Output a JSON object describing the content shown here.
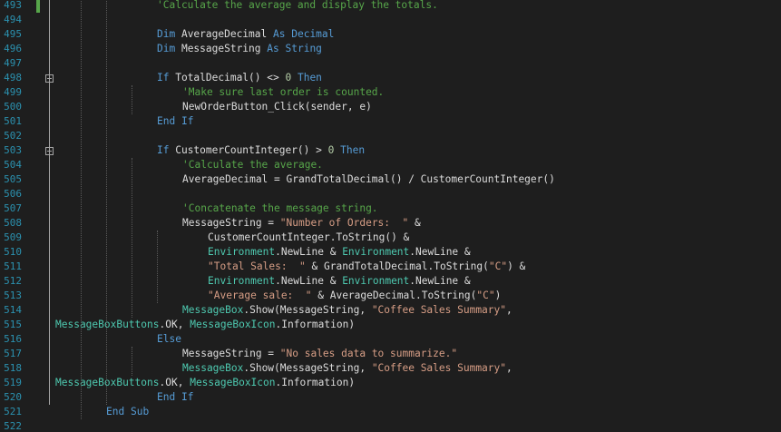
{
  "editor": {
    "lines": [
      {
        "num": "493",
        "indent": 4,
        "tokens": [
          {
            "t": "'Calculate the average and display the totals.",
            "c": "comment"
          }
        ]
      },
      {
        "num": "494",
        "indent": 0,
        "tokens": []
      },
      {
        "num": "495",
        "indent": 4,
        "tokens": [
          {
            "t": "Dim",
            "c": "keyword"
          },
          {
            "t": " AverageDecimal ",
            "c": "plain"
          },
          {
            "t": "As",
            "c": "keyword"
          },
          {
            "t": " ",
            "c": "plain"
          },
          {
            "t": "Decimal",
            "c": "keyword"
          }
        ]
      },
      {
        "num": "496",
        "indent": 4,
        "tokens": [
          {
            "t": "Dim",
            "c": "keyword"
          },
          {
            "t": " MessageString ",
            "c": "plain"
          },
          {
            "t": "As",
            "c": "keyword"
          },
          {
            "t": " ",
            "c": "plain"
          },
          {
            "t": "String",
            "c": "keyword"
          }
        ]
      },
      {
        "num": "497",
        "indent": 0,
        "tokens": []
      },
      {
        "num": "498",
        "indent": 4,
        "tokens": [
          {
            "t": "If",
            "c": "keyword"
          },
          {
            "t": " TotalDecimal() <> ",
            "c": "plain"
          },
          {
            "t": "0",
            "c": "number"
          },
          {
            "t": " ",
            "c": "plain"
          },
          {
            "t": "Then",
            "c": "keyword"
          }
        ]
      },
      {
        "num": "499",
        "indent": 5,
        "tokens": [
          {
            "t": "'Make sure last order is counted.",
            "c": "comment"
          }
        ]
      },
      {
        "num": "500",
        "indent": 5,
        "tokens": [
          {
            "t": "NewOrderButton_Click(sender, e)",
            "c": "plain"
          }
        ]
      },
      {
        "num": "501",
        "indent": 4,
        "tokens": [
          {
            "t": "End",
            "c": "keyword"
          },
          {
            "t": " ",
            "c": "plain"
          },
          {
            "t": "If",
            "c": "keyword"
          }
        ]
      },
      {
        "num": "502",
        "indent": 0,
        "tokens": []
      },
      {
        "num": "503",
        "indent": 4,
        "tokens": [
          {
            "t": "If",
            "c": "keyword"
          },
          {
            "t": " CustomerCountInteger() > ",
            "c": "plain"
          },
          {
            "t": "0",
            "c": "number"
          },
          {
            "t": " ",
            "c": "plain"
          },
          {
            "t": "Then",
            "c": "keyword"
          }
        ]
      },
      {
        "num": "504",
        "indent": 5,
        "tokens": [
          {
            "t": "'Calculate the average.",
            "c": "comment"
          }
        ]
      },
      {
        "num": "505",
        "indent": 5,
        "tokens": [
          {
            "t": "AverageDecimal = GrandTotalDecimal() / CustomerCountInteger()",
            "c": "plain"
          }
        ]
      },
      {
        "num": "506",
        "indent": 0,
        "tokens": []
      },
      {
        "num": "507",
        "indent": 5,
        "tokens": [
          {
            "t": "'Concatenate the message string.",
            "c": "comment"
          }
        ]
      },
      {
        "num": "508",
        "indent": 5,
        "tokens": [
          {
            "t": "MessageString = ",
            "c": "plain"
          },
          {
            "t": "\"Number of Orders:  \"",
            "c": "string"
          },
          {
            "t": " &",
            "c": "plain"
          }
        ]
      },
      {
        "num": "509",
        "indent": 6,
        "tokens": [
          {
            "t": "CustomerCountInteger.ToString() &",
            "c": "plain"
          }
        ]
      },
      {
        "num": "510",
        "indent": 6,
        "tokens": [
          {
            "t": "Environment",
            "c": "type"
          },
          {
            "t": ".NewLine & ",
            "c": "plain"
          },
          {
            "t": "Environment",
            "c": "type"
          },
          {
            "t": ".NewLine &",
            "c": "plain"
          }
        ]
      },
      {
        "num": "511",
        "indent": 6,
        "tokens": [
          {
            "t": "\"Total Sales:  \"",
            "c": "string"
          },
          {
            "t": " & GrandTotalDecimal.ToString(",
            "c": "plain"
          },
          {
            "t": "\"C\"",
            "c": "string"
          },
          {
            "t": ") &",
            "c": "plain"
          }
        ]
      },
      {
        "num": "512",
        "indent": 6,
        "tokens": [
          {
            "t": "Environment",
            "c": "type"
          },
          {
            "t": ".NewLine & ",
            "c": "plain"
          },
          {
            "t": "Environment",
            "c": "type"
          },
          {
            "t": ".NewLine &",
            "c": "plain"
          }
        ]
      },
      {
        "num": "513",
        "indent": 6,
        "tokens": [
          {
            "t": "\"Average sale:  \"",
            "c": "string"
          },
          {
            "t": " & AverageDecimal.ToString(",
            "c": "plain"
          },
          {
            "t": "\"C\"",
            "c": "string"
          },
          {
            "t": ")",
            "c": "plain"
          }
        ]
      },
      {
        "num": "514",
        "indent": 5,
        "tokens": [
          {
            "t": "MessageBox",
            "c": "type"
          },
          {
            "t": ".Show(MessageString, ",
            "c": "plain"
          },
          {
            "t": "\"Coffee Sales Summary\"",
            "c": "string"
          },
          {
            "t": ",",
            "c": "plain"
          }
        ]
      },
      {
        "num": "515",
        "indent": 0,
        "tokens": [
          {
            "t": "MessageBoxButtons",
            "c": "type"
          },
          {
            "t": ".OK, ",
            "c": "plain"
          },
          {
            "t": "MessageBoxIcon",
            "c": "type"
          },
          {
            "t": ".Information)",
            "c": "plain"
          }
        ]
      },
      {
        "num": "516",
        "indent": 4,
        "tokens": [
          {
            "t": "Else",
            "c": "keyword"
          }
        ]
      },
      {
        "num": "517",
        "indent": 5,
        "tokens": [
          {
            "t": "MessageString = ",
            "c": "plain"
          },
          {
            "t": "\"No sales data to summarize.\"",
            "c": "string"
          }
        ]
      },
      {
        "num": "518",
        "indent": 5,
        "tokens": [
          {
            "t": "MessageBox",
            "c": "type"
          },
          {
            "t": ".Show(MessageString, ",
            "c": "plain"
          },
          {
            "t": "\"Coffee Sales Summary\"",
            "c": "string"
          },
          {
            "t": ",",
            "c": "plain"
          }
        ]
      },
      {
        "num": "519",
        "indent": 0,
        "tokens": [
          {
            "t": "MessageBoxButtons",
            "c": "type"
          },
          {
            "t": ".OK, ",
            "c": "plain"
          },
          {
            "t": "MessageBoxIcon",
            "c": "type"
          },
          {
            "t": ".Information)",
            "c": "plain"
          }
        ]
      },
      {
        "num": "520",
        "indent": 4,
        "tokens": [
          {
            "t": "End",
            "c": "keyword"
          },
          {
            "t": " ",
            "c": "plain"
          },
          {
            "t": "If",
            "c": "keyword"
          }
        ]
      },
      {
        "num": "521",
        "indent": 2,
        "tokens": [
          {
            "t": "End",
            "c": "keyword"
          },
          {
            "t": " ",
            "c": "plain"
          },
          {
            "t": "Sub",
            "c": "keyword"
          }
        ]
      },
      {
        "num": "522",
        "indent": 0,
        "tokens": []
      }
    ],
    "colors": {
      "background": "#1e1e1e",
      "line_number": "#2b91af",
      "keyword": "#569cd6",
      "comment": "#57a64a",
      "string": "#d69d85",
      "type": "#4ec9b0",
      "plain": "#dcdcdc",
      "change_bar": "#57a64a",
      "fold_box": "#a5a5a5",
      "indent_guide": "#5a5a5a"
    }
  }
}
